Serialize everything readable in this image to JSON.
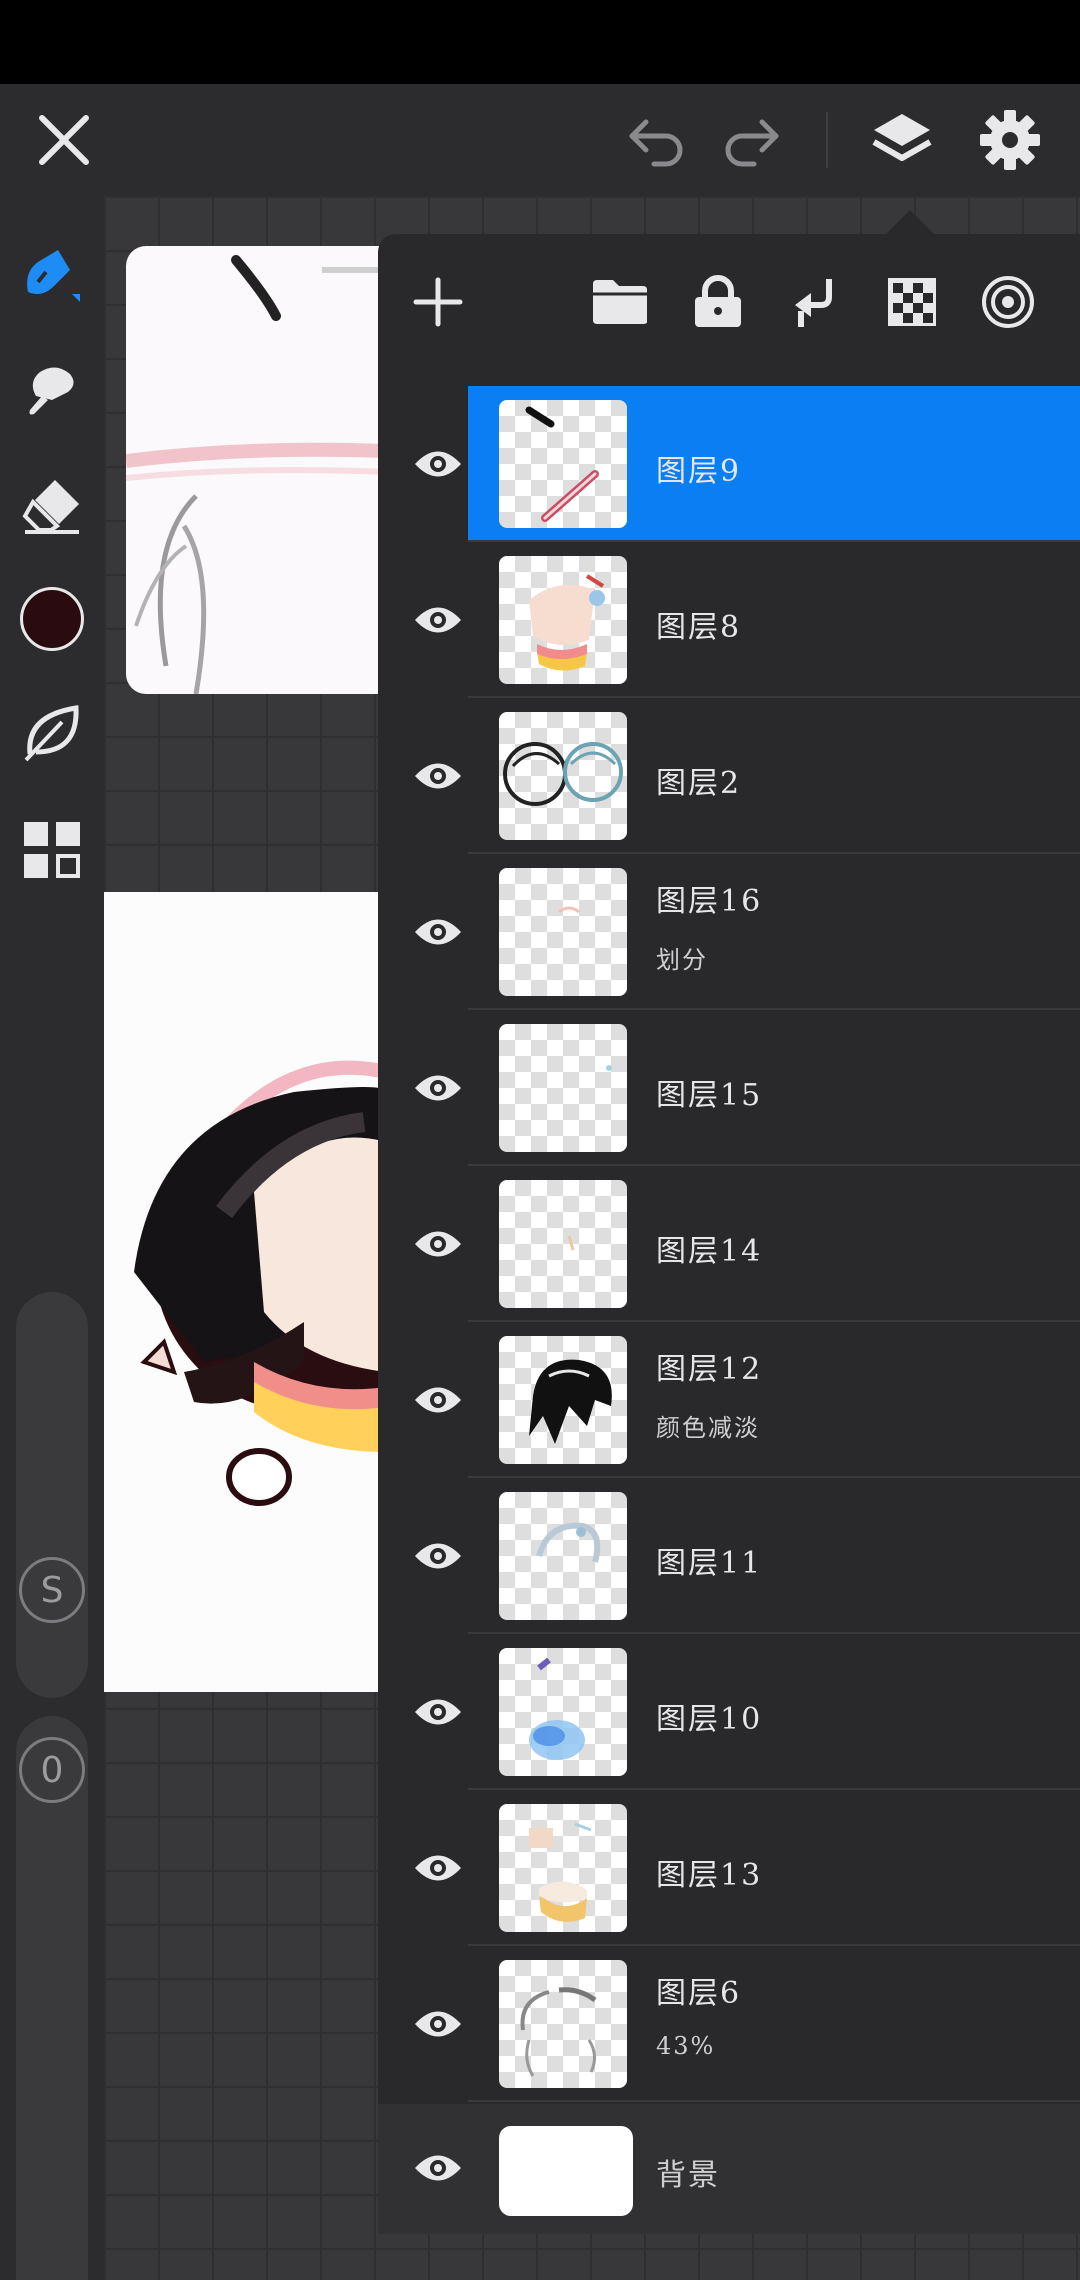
{
  "layers_panel": {
    "layers": [
      {
        "name": "图层9",
        "sub": "",
        "selected": true
      },
      {
        "name": "图层8",
        "sub": "",
        "selected": false
      },
      {
        "name": "图层2",
        "sub": "",
        "selected": false
      },
      {
        "name": "图层16",
        "sub": "划分",
        "selected": false
      },
      {
        "name": "图层15",
        "sub": "",
        "selected": false
      },
      {
        "name": "图层14",
        "sub": "",
        "selected": false
      },
      {
        "name": "图层12",
        "sub": "颜色减淡",
        "selected": false
      },
      {
        "name": "图层11",
        "sub": "",
        "selected": false
      },
      {
        "name": "图层10",
        "sub": "",
        "selected": false
      },
      {
        "name": "图层13",
        "sub": "",
        "selected": false
      },
      {
        "name": "图层6",
        "sub": "43%",
        "selected": false
      }
    ],
    "background_layer": {
      "name": "背景"
    }
  },
  "left_toolbar": {
    "current_color": "#2a0c10",
    "slider_size_label": "S",
    "slider_opacity_label": "0"
  },
  "colors": {
    "accent": "#0a7ef3",
    "panel_bg": "#29292b",
    "toolbar_bg": "#2c2c2f"
  },
  "icons": {
    "top": [
      "close-icon",
      "undo-icon",
      "redo-icon",
      "layers-icon",
      "settings-gear-icon"
    ],
    "panel": [
      "add-layer-icon",
      "folder-icon",
      "lock-icon",
      "merge-down-icon",
      "transparency-icon",
      "radial-icon"
    ],
    "left": [
      "brush-icon",
      "smudge-icon",
      "eraser-icon",
      "color-icon",
      "leaf-icon",
      "grid-icon"
    ]
  }
}
